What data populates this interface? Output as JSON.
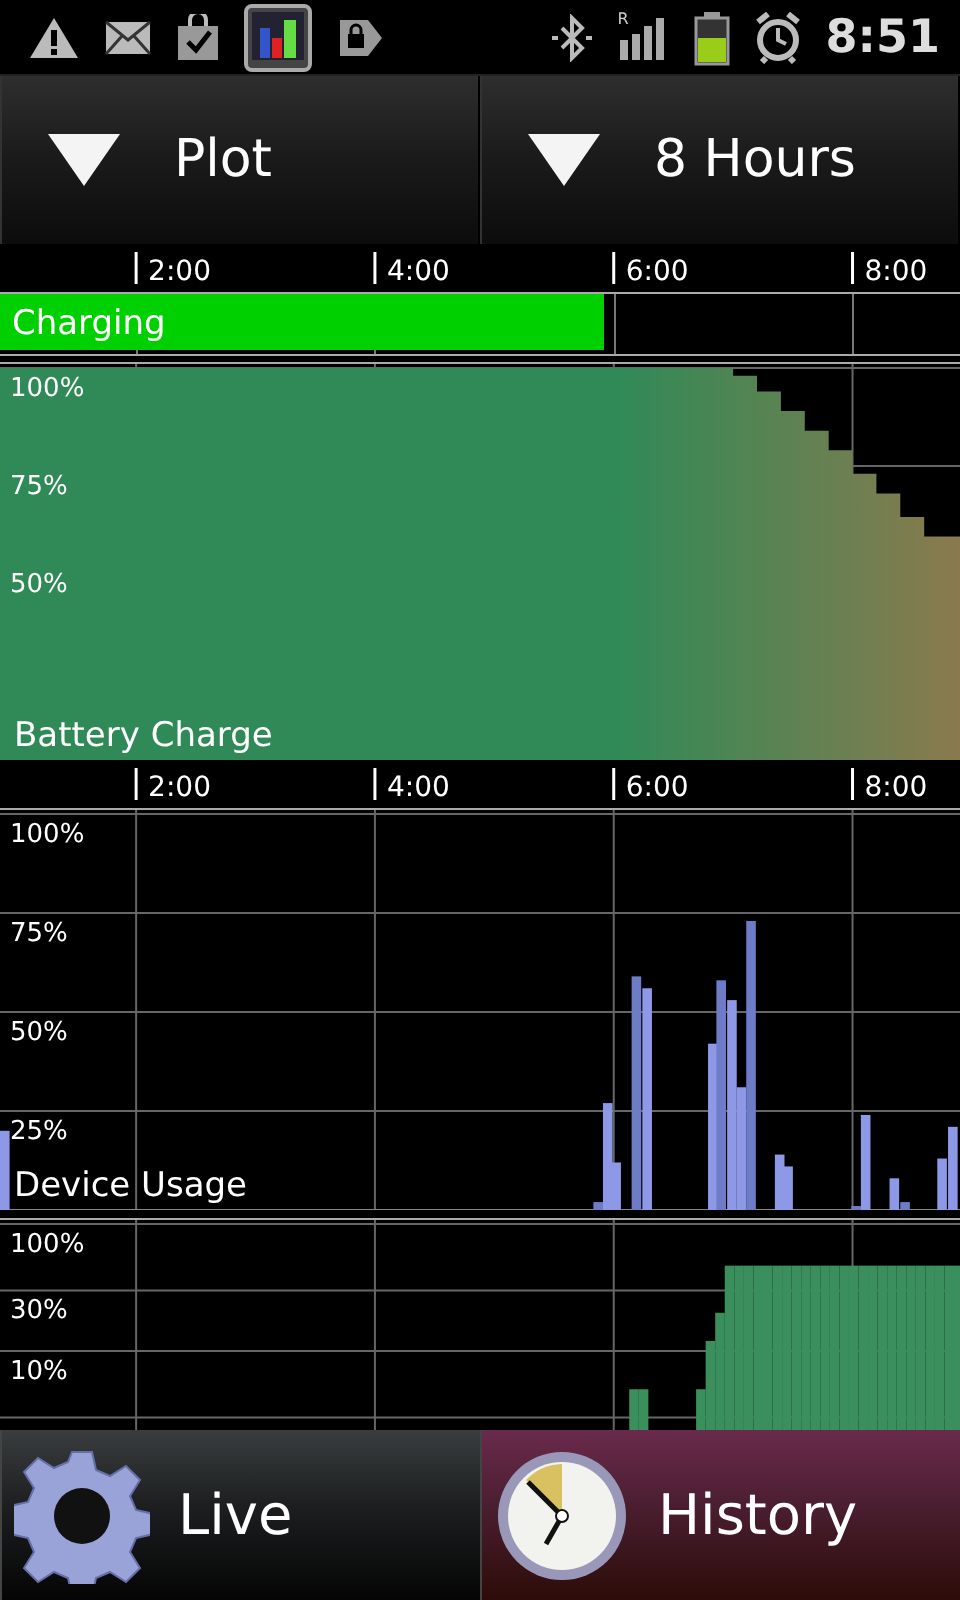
{
  "status_bar": {
    "signal_roaming": "R",
    "time": "8:51"
  },
  "selectors": [
    {
      "label": "Plot"
    },
    {
      "label": "8 Hours"
    }
  ],
  "battery_panel": {
    "time_labels": [
      "2:00",
      "4:00",
      "6:00",
      "8:00"
    ],
    "charging": {
      "label": "Charging",
      "level": 0.63
    },
    "axis_labels": [
      "100%",
      "75%",
      "50%"
    ],
    "title": "Battery Charge"
  },
  "usage_panel": {
    "time_labels": [
      "2:00",
      "4:00",
      "6:00",
      "8:00"
    ],
    "axis_labels": [
      "100%",
      "75%",
      "50%",
      "25%"
    ],
    "title": "Device Usage"
  },
  "network_panel": {
    "axis_labels": [
      "100%",
      "30%",
      "10%"
    ]
  },
  "tabs": [
    {
      "label": "Live",
      "selected": false
    },
    {
      "label": "History",
      "selected": true
    }
  ]
}
